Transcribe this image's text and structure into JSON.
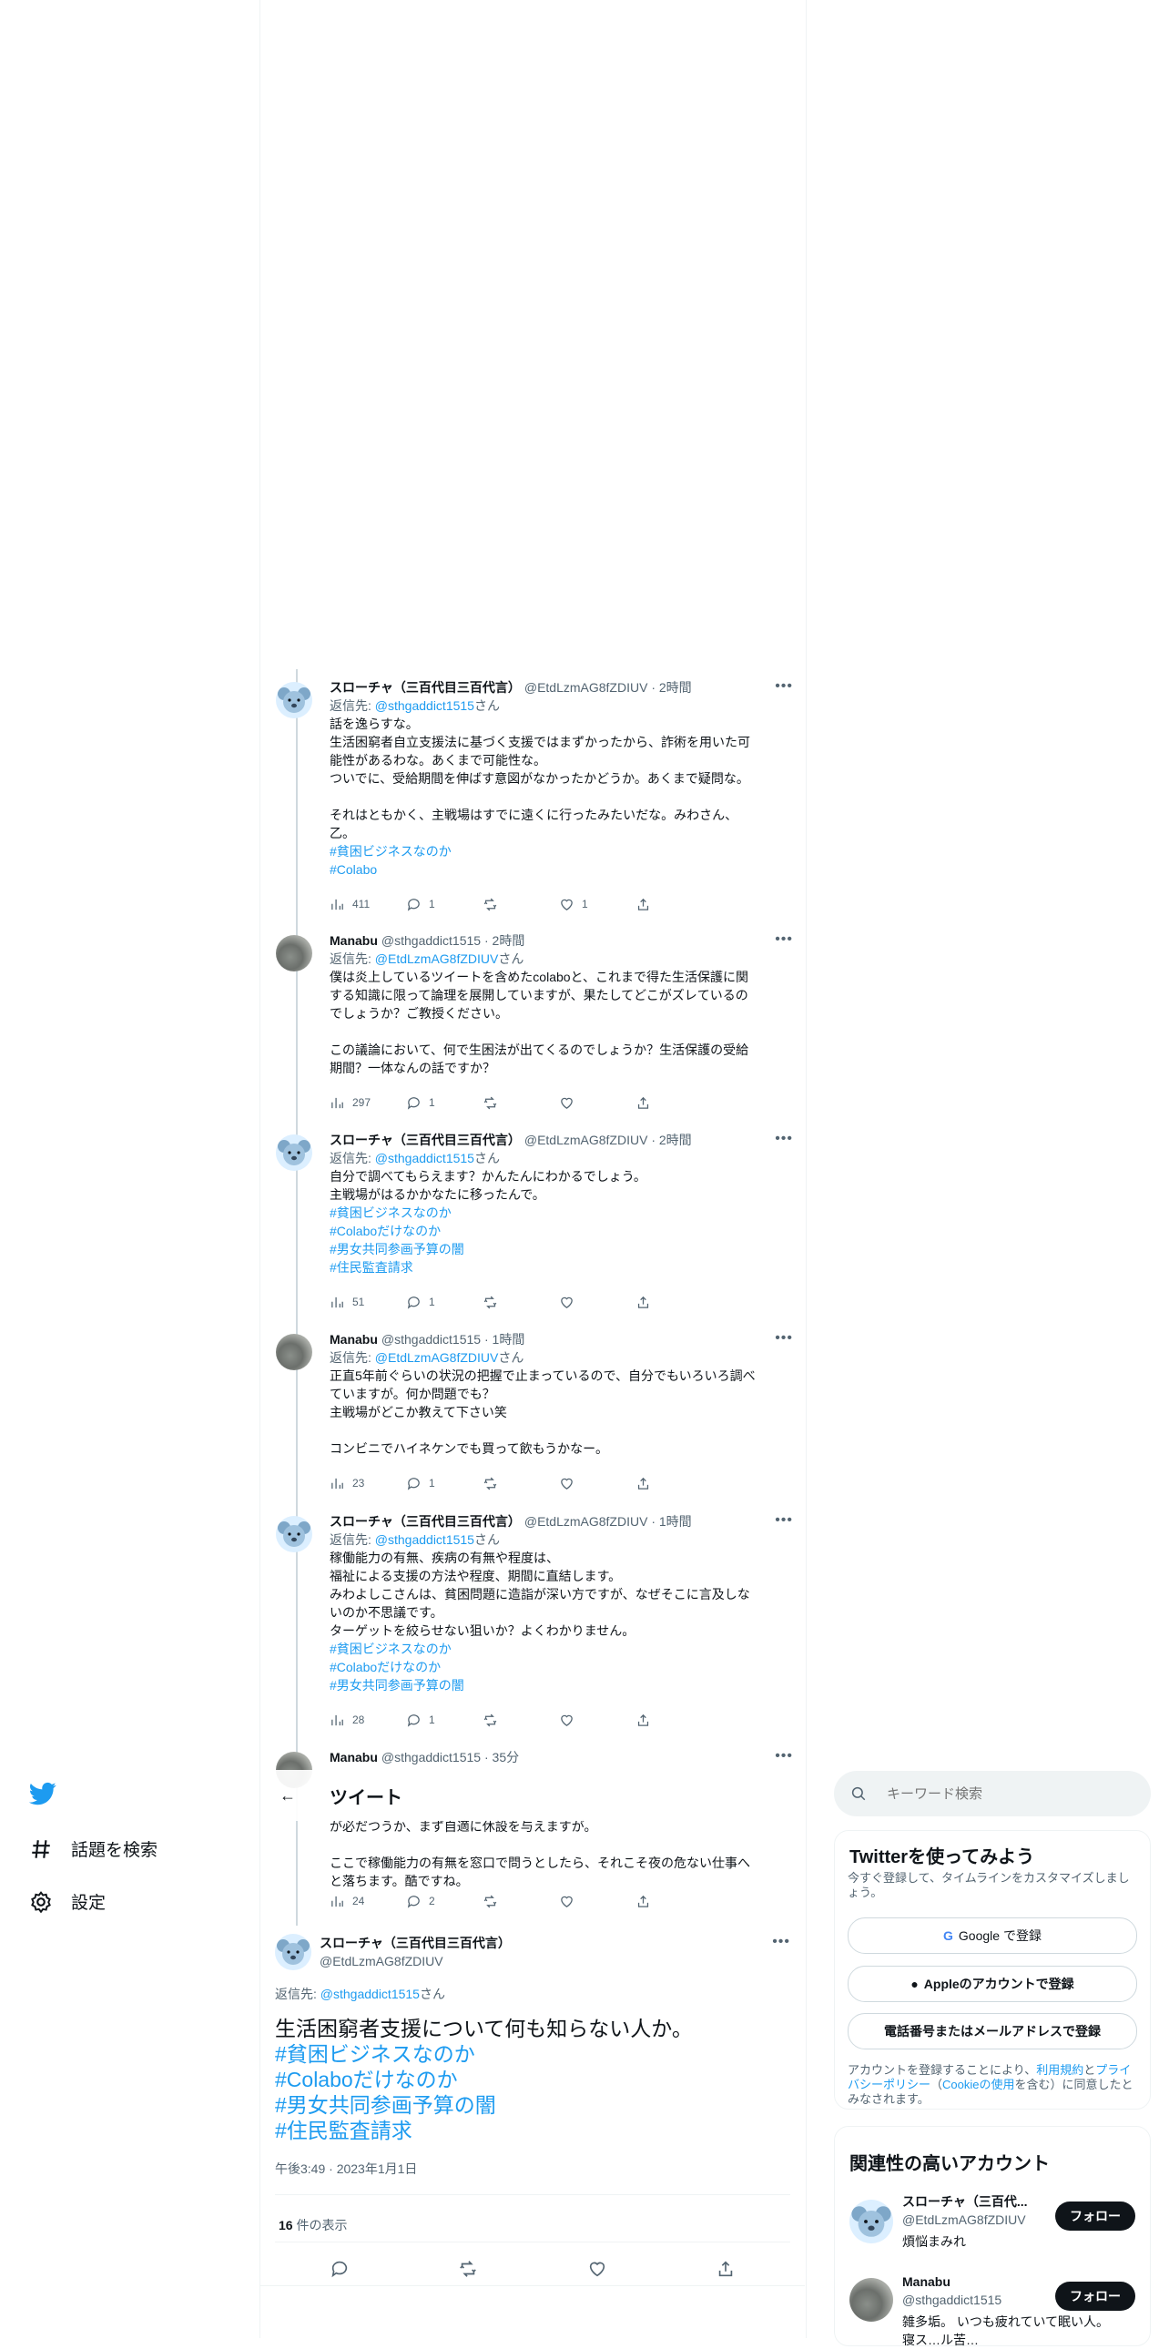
{
  "nav": {
    "explore_label": "話題を検索",
    "settings_label": "設定"
  },
  "header": {
    "back": "←",
    "title": "ツイート"
  },
  "replies": [
    {
      "name": "スローチャ（三百代目三百代言）",
      "handle": "@EtdLzmAG8fZDIUV",
      "time": "2時間",
      "reply_to_prefix": "返信先: ",
      "reply_to": "@sthgaddict1515",
      "reply_to_suffix": "さん",
      "text_lines": [
        "話を逸らすな。",
        "生活困窮者自立支援法に基づく支援ではまずかったから、詐術を用いた可",
        "能性があるわな。あくまで可能性な。",
        "ついでに、受給期間を伸ばす意図がなかったかどうか。あくまで疑問な。",
        "",
        "それはともかく、主戦場はすでに遠くに行ったみたいだな。みわさん、",
        "乙。"
      ],
      "hashtags": [
        "#貧困ビジネスなのか",
        "#Colabo"
      ],
      "views": "411",
      "replies_count": "1",
      "retweets": "",
      "likes": "1"
    },
    {
      "name": "Manabu",
      "handle": "@sthgaddict1515",
      "time": "2時間",
      "reply_to_prefix": "返信先: ",
      "reply_to": "@EtdLzmAG8fZDIUV",
      "reply_to_suffix": "さん",
      "text_lines": [
        "僕は炎上しているツイートを含めたcolaboと、これまで得た生活保護に関",
        "する知識に限って論理を展開していますが、果たしてどこがズレているの",
        "でしょうか？ご教授ください。",
        "",
        "この議論において、何で生困法が出てくるのでしょうか？生活保護の受給",
        "期間？一体なんの話ですか？"
      ],
      "hashtags": [],
      "views": "297",
      "replies_count": "1",
      "retweets": "",
      "likes": ""
    },
    {
      "name": "スローチャ（三百代目三百代言）",
      "handle": "@EtdLzmAG8fZDIUV",
      "time": "2時間",
      "reply_to_prefix": "返信先: ",
      "reply_to": "@sthgaddict1515",
      "reply_to_suffix": "さん",
      "text_lines": [
        "自分で調べてもらえます？かんたんにわかるでしょう。",
        "主戦場がはるかかなたに移ったんで。"
      ],
      "hashtags": [
        "#貧困ビジネスなのか",
        "#Colaboだけなのか",
        "#男女共同参画予算の闇",
        "#住民監査請求"
      ],
      "views": "51",
      "replies_count": "1",
      "retweets": "",
      "likes": ""
    },
    {
      "name": "Manabu",
      "handle": "@sthgaddict1515",
      "time": "1時間",
      "reply_to_prefix": "返信先: ",
      "reply_to": "@EtdLzmAG8fZDIUV",
      "reply_to_suffix": "さん",
      "text_lines": [
        "正直5年前ぐらいの状況の把握で止まっているので、自分でもいろいろ調べ",
        "ていますが。何か問題でも？",
        "主戦場がどこか教えて下さい笑",
        "",
        "コンビニでハイネケンでも買って飲もうかなー。"
      ],
      "hashtags": [],
      "views": "23",
      "replies_count": "1",
      "retweets": "",
      "likes": ""
    },
    {
      "name": "スローチャ（三百代目三百代言）",
      "handle": "@EtdLzmAG8fZDIUV",
      "time": "1時間",
      "reply_to_prefix": "返信先: ",
      "reply_to": "@sthgaddict1515",
      "reply_to_suffix": "さん",
      "text_lines": [
        "稼働能力の有無、疾病の有無や程度は、",
        "福祉による支援の方法や程度、期間に直結します。",
        "みわよしこさんは、貧困問題に造詣が深い方ですが、なぜそこに言及しな",
        "いのか不思議です。",
        "ターゲットを絞らせない狙いか？よくわかりません。"
      ],
      "hashtags": [
        "#貧困ビジネスなのか",
        "#Colaboだけなのか",
        "#男女共同参画予算の闇"
      ],
      "views": "28",
      "replies_count": "1",
      "retweets": "",
      "likes": ""
    },
    {
      "name": "Manabu",
      "handle": "@sthgaddict1515",
      "time": "35分",
      "text_lines": [
        "が必だつうか、まず自適に休設を与えますが。",
        "",
        "ここで稼働能力の有無を窓口で問うとしたら、それこそ夜の危ない仕事へ",
        "と落ちます。酷ですね。"
      ],
      "views": "24",
      "replies_count": "2",
      "retweets": "",
      "likes": ""
    }
  ],
  "main_tweet": {
    "name": "スローチャ（三百代目三百代言）",
    "handle": "@EtdLzmAG8fZDIUV",
    "reply_to_prefix": "返信先: ",
    "reply_to": "@sthgaddict1515",
    "reply_to_suffix": "さん",
    "text": "生活困窮者支援について何も知らない人か。",
    "hashtags": [
      "#貧困ビジネスなのか",
      "#Colaboだけなのか",
      "#男女共同参画予算の闇",
      "#住民監査請求"
    ],
    "timestamp": "午後3:49 · 2023年1月1日",
    "views_count": "16",
    "views_label": "件の表示"
  },
  "sidebar": {
    "search_placeholder": "キーワード検索",
    "signup": {
      "title": "Twitterを使ってみよう",
      "subtitle": "今すぐ登録して、タイムラインをカスタマイズしましょう。",
      "google_label": "Google で登録",
      "apple_label": "Appleのアカウントで登録",
      "phone_label": "電話番号またはメールアドレスで登録",
      "legal_prefix": "アカウントを登録することにより、",
      "terms": "利用規約",
      "and": "と",
      "privacy": "プライバシーポリシー",
      "cookie_open": "（",
      "cookie": "Cookieの使用",
      "legal_suffix": "を含む）に同意したとみなされます。"
    },
    "relevant": {
      "title": "関連性の高いアカウント",
      "accounts": [
        {
          "name": "スローチャ（三百代...",
          "handle": "@EtdLzmAG8fZDIUV",
          "bio": "煩悩まみれ",
          "follow": "フォロー"
        },
        {
          "name": "Manabu",
          "handle": "@sthgaddict1515",
          "bio": "雑多垢。 いつも疲れていて眠い人。",
          "bio2": "寝ス…ル苦…",
          "follow": "フォロー"
        }
      ]
    }
  }
}
